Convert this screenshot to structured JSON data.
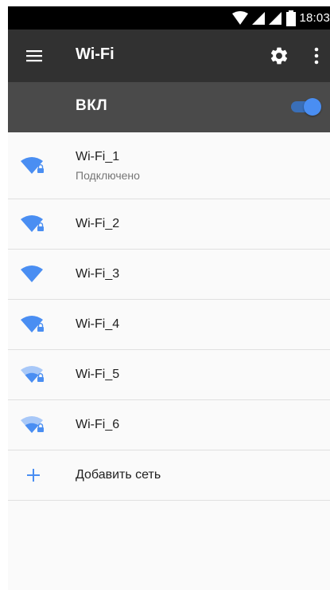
{
  "status_bar": {
    "time": "18:03"
  },
  "toolbar": {
    "title": "Wi-Fi"
  },
  "master_switch": {
    "label": "ВКЛ",
    "on": true
  },
  "networks": [
    {
      "ssid": "Wi-Fi_1",
      "status": "Подключено",
      "strength": 4,
      "secured": true
    },
    {
      "ssid": "Wi-Fi_2",
      "strength": 4,
      "secured": true
    },
    {
      "ssid": "Wi-Fi_3",
      "strength": 4,
      "secured": false
    },
    {
      "ssid": "Wi-Fi_4",
      "strength": 4,
      "secured": true
    },
    {
      "ssid": "Wi-Fi_5",
      "strength": 2,
      "secured": true
    },
    {
      "ssid": "Wi-Fi_6",
      "strength": 2,
      "secured": true
    }
  ],
  "add_network": {
    "label": "Добавить сеть"
  },
  "colors": {
    "accent": "#4a8ef2",
    "wifi_weak": "#a8c8f8",
    "toolbar": "#313131",
    "switch_bar": "#4a4a4a"
  },
  "icons": [
    "wifi-signal-icon",
    "lock-icon",
    "menu-icon",
    "gear-icon",
    "more-vert-icon",
    "plus-icon"
  ]
}
